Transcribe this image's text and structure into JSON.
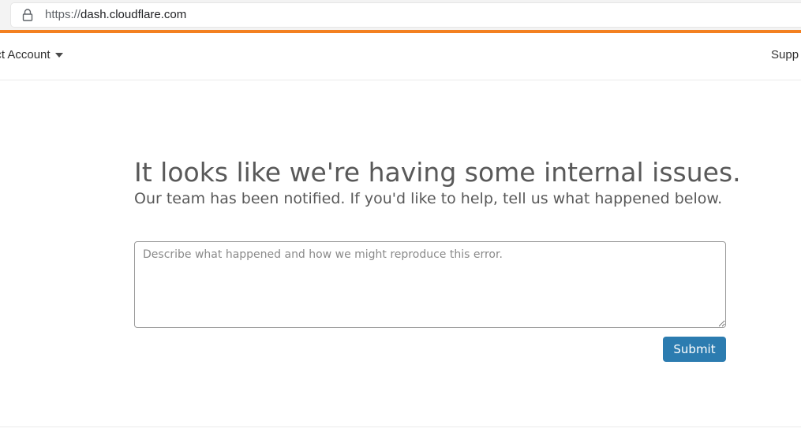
{
  "browser": {
    "url_scheme": "https://",
    "url_host": "dash.cloudflare.com",
    "accent_color": "#f38020"
  },
  "header": {
    "account_selector_label": "ect Account",
    "support_label": "Supp"
  },
  "error": {
    "title": "It looks like we're having some internal issues.",
    "subtitle": "Our team has been notified. If you'd like to help, tell us what happened below.",
    "feedback_placeholder": "Describe what happened and how we might reproduce this error.",
    "feedback_value": "",
    "submit_label": "Submit",
    "submit_color": "#2c7cb0"
  }
}
